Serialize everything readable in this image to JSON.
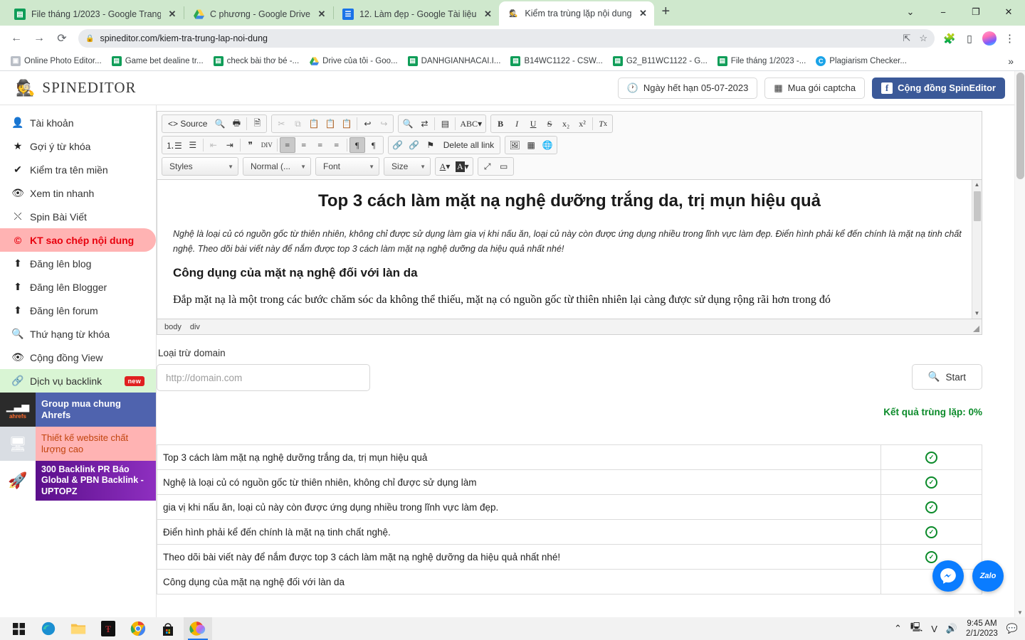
{
  "browser": {
    "tabs": [
      {
        "title": "File tháng 1/2023 - Google Trang",
        "favicon": "sheets-icon",
        "active": false
      },
      {
        "title": "C phương - Google Drive",
        "favicon": "drive-icon",
        "active": false
      },
      {
        "title": "12. Làm đẹp - Google Tài liệu",
        "favicon": "docs-icon",
        "active": false
      },
      {
        "title": "Kiểm tra trùng lặp nội dung",
        "favicon": "spineditor-icon",
        "active": true
      }
    ],
    "new_tab_label": "+",
    "window_controls": {
      "minimize": "−",
      "maximize": "❐",
      "close": "✕",
      "tab_search": "⌄"
    },
    "nav": {
      "back": "←",
      "forward": "→",
      "reload": "⟳"
    },
    "omnibox": {
      "url": "spineditor.com/kiem-tra-trung-lap-noi-dung",
      "lock": "lock-icon"
    },
    "omnibox_actions": {
      "share": "⇱",
      "bookmark": "☆"
    },
    "extensions_icon": "puzzle-icon",
    "sidepanel_icon": "side-panel-icon",
    "menu_icon": "⋮",
    "bookmarks": [
      {
        "label": "Online Photo Editor...",
        "icon": "photo-icon",
        "color": "#b9bec6"
      },
      {
        "label": "Game bet dealine tr...",
        "icon": "sheets-icon",
        "color": "#0f9d58"
      },
      {
        "label": "check bài thơ bé -...",
        "icon": "sheets-icon",
        "color": "#0f9d58"
      },
      {
        "label": "Drive của tôi - Goo...",
        "icon": "drive-icon",
        "color": "#ffffff"
      },
      {
        "label": "DANHGIANHACAI.I...",
        "icon": "sheets-icon",
        "color": "#0f9d58"
      },
      {
        "label": "B14WC1122 - CSW...",
        "icon": "sheets-icon",
        "color": "#0f9d58"
      },
      {
        "label": "G2_B11WC1122 - G...",
        "icon": "sheets-icon",
        "color": "#0f9d58"
      },
      {
        "label": "File tháng 1/2023 -...",
        "icon": "sheets-icon",
        "color": "#0f9d58"
      },
      {
        "label": "Plagiarism Checker...",
        "icon": "plagiarism-icon",
        "color": "#1aa3e8"
      }
    ],
    "bookmarks_overflow": "»"
  },
  "app": {
    "brand": "SPINEDITOR",
    "brand_logo": "spy-icon",
    "header_buttons": [
      {
        "label": "Ngày hết hạn 05-07-2023",
        "icon": "clock-icon",
        "style": "plain"
      },
      {
        "label": "Mua gói captcha",
        "icon": "qr-icon",
        "style": "plain"
      },
      {
        "label": "Cộng đồng SpinEditor",
        "icon": "facebook-icon",
        "style": "facebook"
      }
    ]
  },
  "sidebar": {
    "items": [
      {
        "label": "Tài khoản",
        "icon": "user-icon",
        "state": "normal"
      },
      {
        "label": "Gợi ý từ khóa",
        "icon": "star-icon",
        "state": "normal"
      },
      {
        "label": "Kiểm tra tên miền",
        "icon": "check-icon",
        "state": "normal"
      },
      {
        "label": "Xem tin nhanh",
        "icon": "eye-icon",
        "state": "normal"
      },
      {
        "label": "Spin Bài Viết",
        "icon": "shuffle-icon",
        "state": "normal"
      },
      {
        "label": "KT sao chép nội dung",
        "icon": "copyright-icon",
        "state": "active"
      },
      {
        "label": "Đăng lên blog",
        "icon": "upload-icon",
        "state": "normal"
      },
      {
        "label": "Đăng lên Blogger",
        "icon": "upload-icon",
        "state": "normal"
      },
      {
        "label": "Đăng lên forum",
        "icon": "upload-icon",
        "state": "normal"
      },
      {
        "label": "Thứ hạng từ khóa",
        "icon": "search-icon",
        "state": "normal"
      },
      {
        "label": "Cộng đồng View",
        "icon": "eye-icon",
        "state": "normal"
      },
      {
        "label": "Dịch vụ backlink",
        "icon": "link-icon",
        "state": "green",
        "badge": "new"
      }
    ],
    "ads": [
      {
        "label": "Group mua chung Ahrefs",
        "image": "ahrefs-logo"
      },
      {
        "label": "Thiết kế website chất lượng cao",
        "image": "website-design-image"
      },
      {
        "label": "300 Backlink PR Báo Global & PBN Backlink - UPTOPZ",
        "image": "rocket-icon"
      }
    ]
  },
  "editor": {
    "toolbar": {
      "group1": [
        {
          "label": "Source",
          "icon": "source-icon",
          "type": "text"
        },
        {
          "label": "",
          "icon": "preview-icon",
          "type": "icon"
        },
        {
          "label": "",
          "icon": "print-icon",
          "type": "icon"
        },
        {
          "label": "",
          "icon": "templates-icon",
          "type": "icon"
        }
      ],
      "group2": [
        {
          "icon": "cut-icon",
          "disabled": true
        },
        {
          "icon": "copy-icon",
          "disabled": true
        },
        {
          "icon": "paste-icon",
          "disabled": false
        },
        {
          "icon": "paste-text-icon",
          "disabled": false
        },
        {
          "icon": "paste-word-icon",
          "disabled": false
        },
        {
          "icon": "undo-icon",
          "disabled": false
        },
        {
          "icon": "redo-icon",
          "disabled": true
        }
      ],
      "group3": [
        {
          "icon": "find-icon"
        },
        {
          "icon": "replace-icon"
        },
        {
          "icon": "select-all-icon"
        },
        {
          "icon": "spellcheck-icon"
        }
      ],
      "group4": [
        {
          "icon": "bold-icon",
          "label": "B"
        },
        {
          "icon": "italic-icon",
          "label": "I"
        },
        {
          "icon": "underline-icon",
          "label": "U"
        },
        {
          "icon": "strike-icon",
          "label": "S"
        },
        {
          "icon": "subscript-icon",
          "label": "x₂"
        },
        {
          "icon": "superscript-icon",
          "label": "x²"
        },
        {
          "icon": "remove-format-icon",
          "label": "Tx"
        }
      ],
      "group5": [
        {
          "icon": "numbered-list-icon"
        },
        {
          "icon": "bulleted-list-icon"
        },
        {
          "icon": "outdent-icon",
          "disabled": true
        },
        {
          "icon": "indent-icon"
        },
        {
          "icon": "blockquote-icon"
        },
        {
          "icon": "create-div-icon"
        },
        {
          "icon": "align-left-icon",
          "on": true
        },
        {
          "icon": "align-center-icon"
        },
        {
          "icon": "align-right-icon"
        },
        {
          "icon": "align-justify-icon"
        },
        {
          "icon": "ltr-icon",
          "on": true
        },
        {
          "icon": "rtl-icon"
        }
      ],
      "group6": [
        {
          "icon": "link-icon"
        },
        {
          "icon": "unlink-icon",
          "disabled": true
        },
        {
          "icon": "anchor-icon"
        },
        {
          "icon": "delete-all-link-icon",
          "label": "Delete all link"
        }
      ],
      "group7": [
        {
          "icon": "image-icon"
        },
        {
          "icon": "table-icon"
        },
        {
          "icon": "iframe-icon"
        }
      ],
      "selects": [
        {
          "name": "styles",
          "value": "Styles"
        },
        {
          "name": "format",
          "value": "Normal (..."
        },
        {
          "name": "font",
          "value": "Font"
        },
        {
          "name": "size",
          "value": "Size"
        }
      ],
      "group8": [
        {
          "icon": "text-color-icon",
          "label": "A"
        },
        {
          "icon": "bg-color-icon",
          "label": "A"
        }
      ],
      "group9": [
        {
          "icon": "maximize-icon"
        },
        {
          "icon": "show-blocks-icon"
        }
      ]
    },
    "content": {
      "title": "Top 3 cách làm mặt nạ nghệ dưỡng trắng da, trị mụn hiệu quả",
      "intro": "Nghệ là loại củ có nguồn gốc từ thiên nhiên, không chỉ được sử dụng làm gia vị khi nấu ăn, loại củ này còn được ứng dụng nhiều trong lĩnh vực làm đẹp. Điển hình phải kể đến chính là mặt nạ tinh chất nghệ. Theo dõi bài viết này để nắm được top 3 cách làm mặt nạ nghệ dưỡng da hiệu quả nhất nhé!",
      "heading2": "Công dụng của mặt nạ nghệ đối với làn da",
      "paragraph": "Đắp mặt nạ là một trong các bước chăm sóc da không thể thiếu, mặt nạ có nguồn gốc từ thiên nhiên lại càng được sử dụng rộng rãi hơn trong đó"
    },
    "path": [
      "body",
      "div"
    ]
  },
  "form": {
    "domain_label": "Loại trừ domain",
    "domain_placeholder": "http://domain.com",
    "domain_value": "",
    "start_label": "Start",
    "start_icon": "search-icon",
    "result_label": "Kết quả trùng lặp: 0%"
  },
  "results": {
    "rows": [
      {
        "text": "Top 3 cách làm mặt nạ nghệ dưỡng trắng da, trị mụn hiệu quả",
        "status": "ok"
      },
      {
        "text": "Nghệ là loại củ có nguồn gốc từ thiên nhiên, không chỉ được sử dụng làm",
        "status": "ok"
      },
      {
        "text": "gia vị khi nấu ăn, loại củ này còn được ứng dụng nhiều trong lĩnh vực làm đẹp.",
        "status": "ok"
      },
      {
        "text": "Điển hình phải kể đến chính là mặt nạ tinh chất nghệ.",
        "status": "ok"
      },
      {
        "text": "Theo dõi bài viết này để nắm được top 3 cách làm mặt nạ nghệ dưỡng da hiệu quả nhất nhé!",
        "status": "ok"
      },
      {
        "text": "Công dụng của mặt nạ nghệ đối với làn da",
        "status": "ok"
      }
    ],
    "status_glyph": "✓"
  },
  "chat": {
    "messenger_label": "messenger-icon",
    "zalo_label": "Zalo"
  },
  "taskbar": {
    "items": [
      {
        "icon": "windows-start-icon"
      },
      {
        "icon": "edge-icon"
      },
      {
        "icon": "file-explorer-icon"
      },
      {
        "icon": "app-red-icon"
      },
      {
        "icon": "chrome-icon"
      },
      {
        "icon": "microsoft-store-icon"
      },
      {
        "icon": "chrome-active-icon",
        "active": true
      }
    ],
    "tray": {
      "chevron": "⌃",
      "network": "network-icon",
      "vpn": "V",
      "volume": "volume-icon",
      "time": "9:45 AM",
      "date": "2/1/2023",
      "notifications": "notification-icon"
    }
  },
  "colors": {
    "tab_bar": "#cfe8cd",
    "sidebar_active": "#ffb3b3",
    "sidebar_active_text": "#e8000d",
    "facebook": "#3b5998",
    "success_green": "#0a8a29"
  }
}
